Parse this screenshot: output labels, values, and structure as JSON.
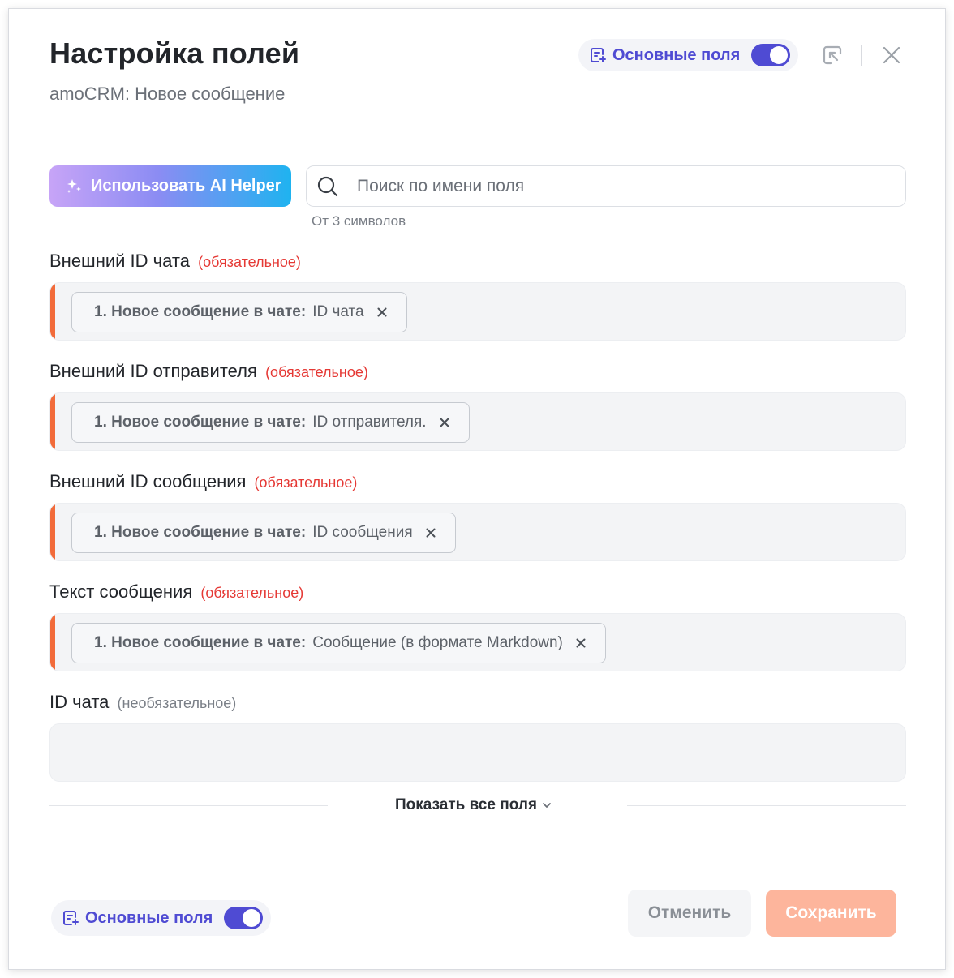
{
  "header": {
    "title": "Настройка полей",
    "subtitle": "amoCRM: Новое сообщение",
    "main_fields_toggle": {
      "label": "Основные поля",
      "checked": true
    }
  },
  "toolbar": {
    "ai_helper_label": "Использовать AI Helper",
    "search": {
      "placeholder": "Поиск по имени поля",
      "value": "",
      "hint": "От 3 символов"
    }
  },
  "fields": [
    {
      "label": "Внешний ID чата",
      "badge": "(обязательное)",
      "required": true,
      "chip": {
        "source": "1. Новое сообщение в чате:",
        "value": "ID чата"
      }
    },
    {
      "label": "Внешний ID отправителя",
      "badge": "(обязательное)",
      "required": true,
      "chip": {
        "source": "1. Новое сообщение в чате:",
        "value": "ID отправителя."
      }
    },
    {
      "label": "Внешний ID сообщения",
      "badge": "(обязательное)",
      "required": true,
      "chip": {
        "source": "1. Новое сообщение в чате:",
        "value": "ID сообщения"
      }
    },
    {
      "label": "Текст сообщения",
      "badge": "(обязательное)",
      "required": true,
      "chip": {
        "source": "1. Новое сообщение в чате:",
        "value": "Сообщение (в формате Markdown)"
      }
    },
    {
      "label": "ID чата",
      "badge": "(необязательное)",
      "required": false,
      "chip": null
    }
  ],
  "show_all_label": "Показать все поля",
  "footer": {
    "main_fields_toggle": {
      "label": "Основные поля",
      "checked": true
    },
    "cancel_label": "Отменить",
    "save_label": "Сохранить"
  },
  "colors": {
    "accent": "#4f4bd3",
    "required": "#e53935",
    "error_bar": "#f26b3a",
    "save_button": "#fdb59c"
  },
  "icons": {
    "toggle": "fields-list-icon",
    "collapse": "collapse-arrow-icon",
    "close": "close-icon",
    "ai": "sparkle-icon",
    "search": "search-icon",
    "chip_remove": "remove-icon",
    "show_all": "chevron-down-icon"
  }
}
